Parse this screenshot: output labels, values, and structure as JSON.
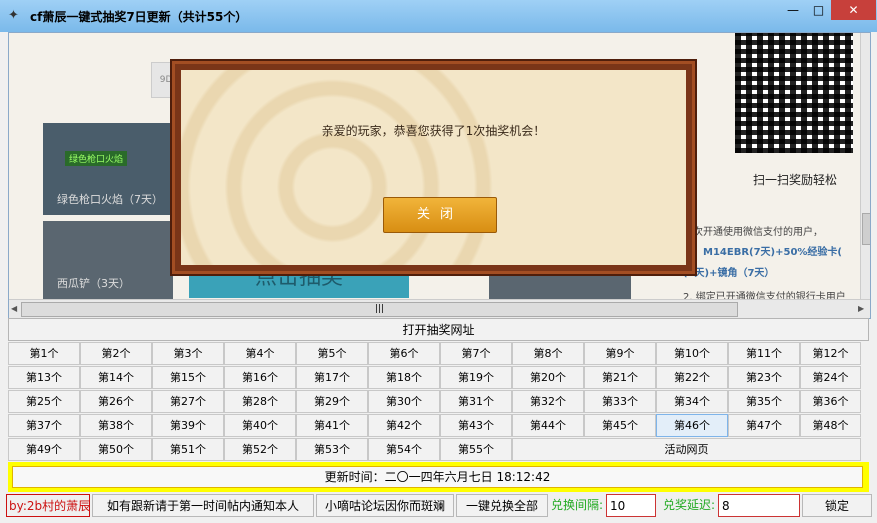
{
  "window": {
    "title": "cf萧辰一键式抽奖7日更新（共计55个）",
    "min": "—",
    "max": "□",
    "close": "✕"
  },
  "browser": {
    "item1_label": "绿色枪口火焰（7天）",
    "item1_badge": "绿色枪口火焰",
    "item2_label": "西瓜铲（3天）",
    "center_button": "点击抽奖",
    "qr_caption": "扫一扫奖励轻松",
    "right_text1": "首次开通使用微信支付的用户，",
    "right_text2": "得。M14EBR(7天)+50%经验卡(",
    "right_text3": "(7天)+镜角（7天）",
    "right_text4": "2. 绑定已开通微信支付的银行卡用户",
    "input_hint": "9D6"
  },
  "dialog": {
    "message": "亲爱的玩家，恭喜您获得了1次抽奖机会！",
    "close_label": "关闭"
  },
  "open_label": "打开抽奖网址",
  "buttons": [
    "第1个",
    "第2个",
    "第3个",
    "第4个",
    "第5个",
    "第6个",
    "第7个",
    "第8个",
    "第9个",
    "第10个",
    "第11个",
    "第12个",
    "第13个",
    "第14个",
    "第15个",
    "第16个",
    "第17个",
    "第18个",
    "第19个",
    "第20个",
    "第21个",
    "第22个",
    "第23个",
    "第24个",
    "第25个",
    "第26个",
    "第27个",
    "第28个",
    "第29个",
    "第30个",
    "第31个",
    "第32个",
    "第33个",
    "第34个",
    "第35个",
    "第36个",
    "第37个",
    "第38个",
    "第39个",
    "第40个",
    "第41个",
    "第42个",
    "第43个",
    "第44个",
    "第45个",
    "第46个",
    "第47个",
    "第48个",
    "第49个",
    "第50个",
    "第51个",
    "第52个",
    "第53个",
    "第54个",
    "第55个"
  ],
  "activity_label": "活动网页",
  "update_text": "更新时间：二〇一四年六月七日  18:12:42",
  "bottom": {
    "author": "by:2b村的萧辰",
    "notice": "如有跟新请于第一时间帖内通知本人",
    "forum": "小嘀咕论坛因你而斑斓",
    "redeem_all": "一键兑换全部",
    "interval_label": "兑换间隔:",
    "interval_value": "10",
    "delay_label": "兑奖延迟:",
    "delay_value": "8",
    "lock": "锁定"
  }
}
